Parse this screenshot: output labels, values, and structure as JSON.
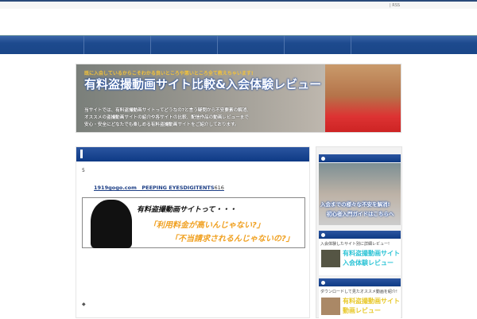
{
  "topbar": {
    "rss": "| RSS"
  },
  "banner": {
    "subtitle": "既に入会しているからこそわかる良いところや悪いところ全て教えちゃいます!",
    "title": "有料盗撮動画サイト比較&入会体験レビュー",
    "description": [
      "当サイトでは、有料盗撮動画サイトってどうなの?と言う疑問から不安要素の解消、",
      "オススメの盗撮動画サイトの紹介や各サイトの比較、配信作品の動画レビューまで",
      "安心・安全にどなたでも楽しめる有料盗撮動画サイトをご紹介しております。"
    ]
  },
  "main": {
    "number": "5",
    "link": "1919gogo.com　PEEPING EYESDIGITENTS",
    "link_tail": "616",
    "promo": {
      "line1": "有料盗撮動画サイトって・・・",
      "line2": "「利用料金が高いんじゃない?」",
      "line3": "「不当請求されるんじゃないの?」"
    },
    "bullet": "◆"
  },
  "sidebar": {
    "widget1": {
      "line1": "入会までの様々な不安を解消!",
      "line2": "初心者入門ガイドはこちらへ"
    },
    "widget2": {
      "text": "入会体験したサイト別に詳細レビュー!",
      "line1": "有料盗撮動画サイト",
      "line2": "入会体験レビュー",
      "color": "#2ec4d6"
    },
    "widget3": {
      "text": "ダウンロードして見たオススメ動画を紹介!",
      "line1": "有料盗撮動画サイト",
      "line2": "動画レビュー",
      "color": "#e8c82a"
    }
  }
}
